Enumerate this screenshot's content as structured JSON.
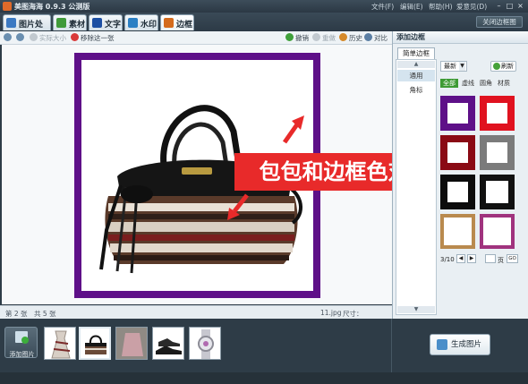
{
  "window": {
    "title": "美图海海 0.9.3 公测版",
    "menu": [
      "文件(F)",
      "编辑(E)",
      "帮助(H)",
      "爱意见(D)"
    ],
    "controls": [
      "–",
      "□",
      "×"
    ]
  },
  "tabs": [
    {
      "label": "图片处理",
      "icon": "image-icon",
      "color": "#3b79c2"
    },
    {
      "label": "素材",
      "icon": "material-icon",
      "color": "#3f9a3a"
    },
    {
      "label": "文字",
      "icon": "text-icon",
      "color": "#1c4fa3"
    },
    {
      "label": "水印",
      "icon": "watermark-icon",
      "color": "#2a7fc4"
    },
    {
      "label": "边框",
      "icon": "frame-icon",
      "color": "#d46b1d"
    }
  ],
  "close_frame_label": "关闭边框图",
  "toolbar": {
    "actual_size": "实际大小",
    "remove_one": "移除这一张",
    "undo": "撤销",
    "reset": "重做",
    "history": "历史",
    "compare": "对比"
  },
  "statusbar": {
    "current": "第 2 张",
    "total": "共 5 张",
    "filename": "11.jpg",
    "dimensions": "尺寸：500x500"
  },
  "right_panel": {
    "header": "添加边框",
    "subtab": "简单边框",
    "categories": [
      "通用",
      "角标"
    ],
    "sort_label": "最新",
    "refresh_label": "刷新",
    "filters": [
      "全部",
      "虚线",
      "圆角",
      "材质"
    ],
    "swatches": [
      {
        "name": "purple-frame",
        "color": "#5e1088"
      },
      {
        "name": "red-frame",
        "color": "#e0121f"
      },
      {
        "name": "dark-red-frame",
        "color": "#8a0a14"
      },
      {
        "name": "gray-frame",
        "color": "#7b7b7b"
      },
      {
        "name": "black-frame",
        "color": "#0c0c0c"
      },
      {
        "name": "black-thin-frame",
        "color": "#111111"
      },
      {
        "name": "wood-frame",
        "color": "#b98a4e"
      },
      {
        "name": "pink-frame",
        "color": "#a0337e"
      }
    ],
    "page": "3/10",
    "page_unit": "页",
    "go": "GO"
  },
  "bottom": {
    "add_image": "添加图片",
    "generate": "生成图片"
  },
  "annotation": "包包和边框色对比",
  "colors": {
    "accent_green": "#3d9a34",
    "annotation_red": "#e82a2a",
    "frame_purple": "#5e1088"
  }
}
